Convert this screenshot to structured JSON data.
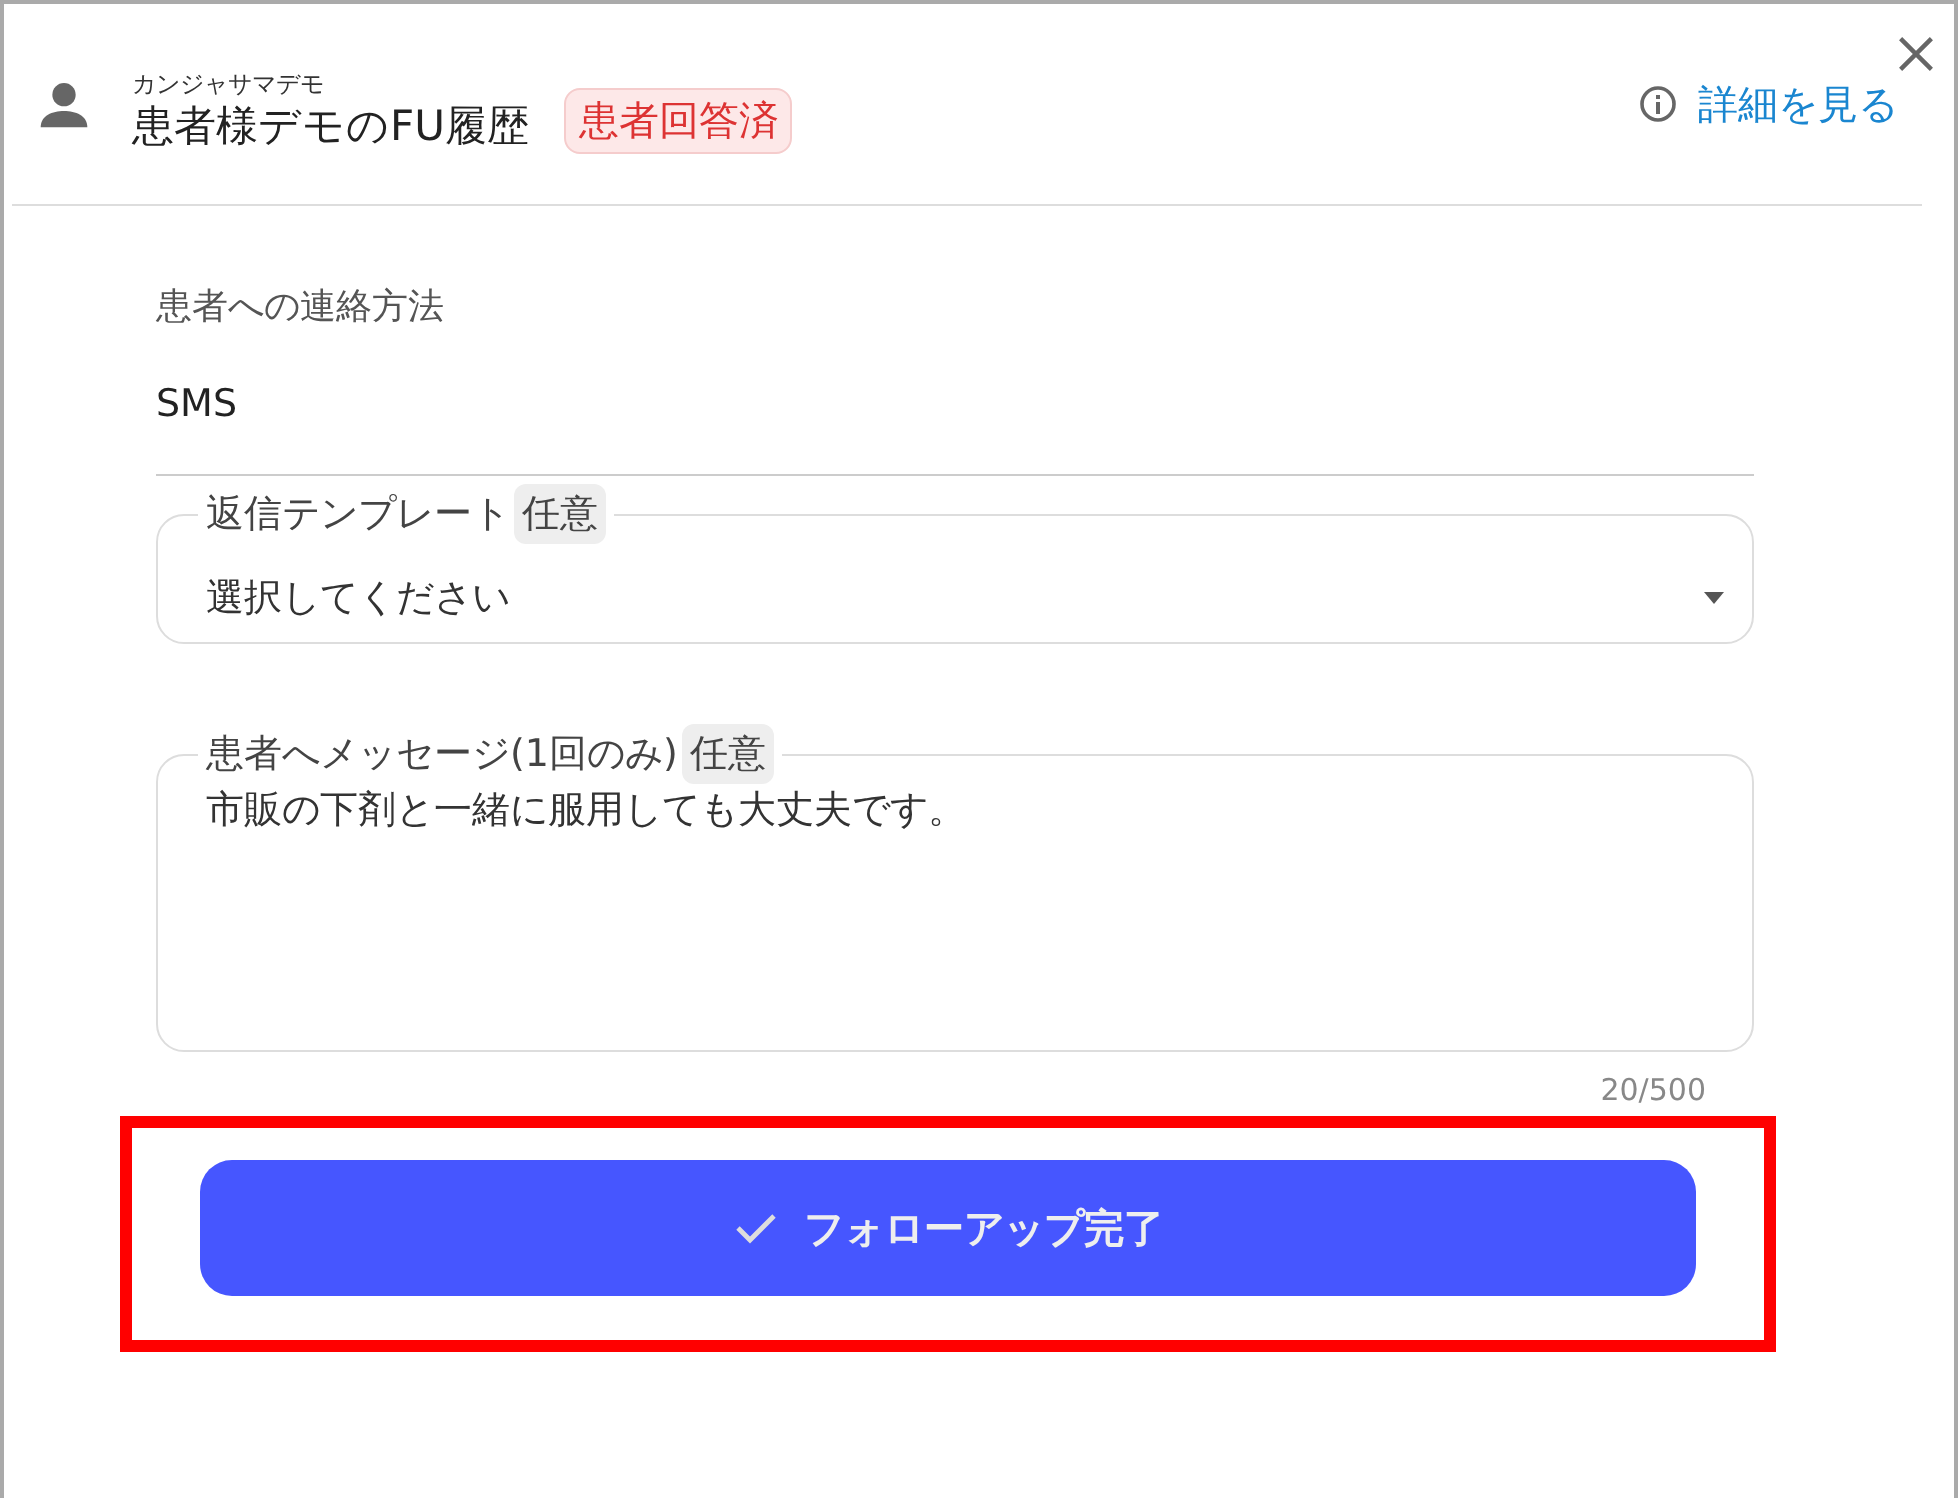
{
  "header": {
    "ruby": "カンジャサマデモ",
    "title": "患者様デモのFU履歴",
    "status_badge": "患者回答済",
    "details_link": "詳細を見る"
  },
  "contact": {
    "label": "患者への連絡方法",
    "value": "SMS"
  },
  "template_select": {
    "label": "返信テンプレート",
    "optional_chip": "任意",
    "placeholder": "選択してください"
  },
  "message_field": {
    "label": "患者へメッセージ(1回のみ)",
    "optional_chip": "任意",
    "value": "市販の下剤と一緒に服用しても大丈夫です。",
    "counter": "20/500"
  },
  "complete_button": {
    "label": "フォローアップ完了"
  }
}
